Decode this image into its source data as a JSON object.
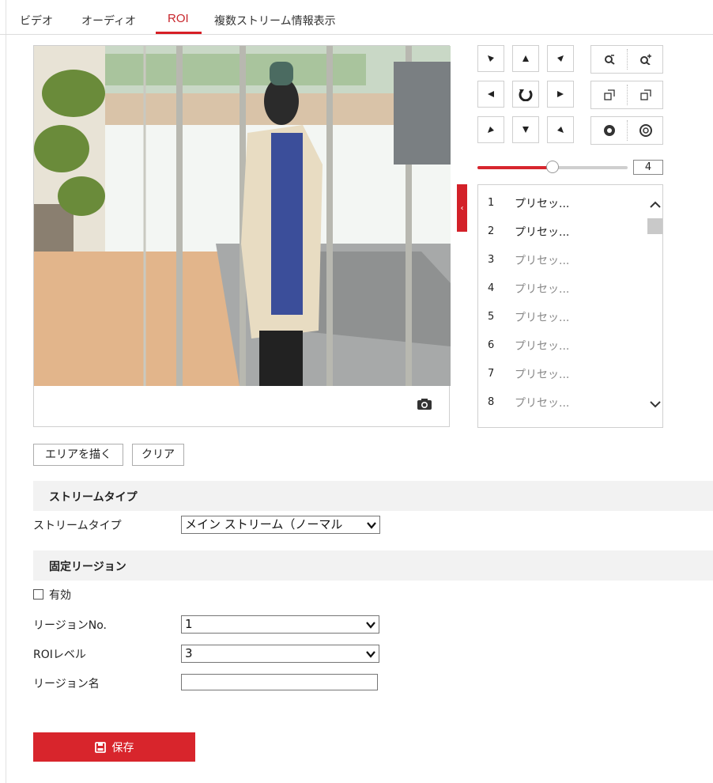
{
  "tabs": [
    {
      "label": "ビデオ"
    },
    {
      "label": "オーディオ"
    },
    {
      "label": "ROI",
      "active": true
    },
    {
      "label": "複数ストリーム情報表示"
    }
  ],
  "colors": {
    "accent": "#d8252c"
  },
  "ptz": {
    "direction_icons": [
      "arrow-up-left-icon",
      "arrow-up-icon",
      "arrow-up-right-icon",
      "arrow-left-icon",
      "auto-rotate-icon",
      "arrow-right-icon",
      "arrow-down-left-icon",
      "arrow-down-icon",
      "arrow-down-right-icon"
    ],
    "lens_icons": [
      "zoom-out-icon",
      "zoom-in-icon",
      "focus-near-icon",
      "focus-far-icon",
      "iris-close-icon",
      "iris-open-icon"
    ],
    "speed": {
      "value": "4",
      "level": 0.5
    }
  },
  "presets": [
    {
      "num": "1",
      "name": "プリセッ..."
    },
    {
      "num": "2",
      "name": "プリセッ..."
    },
    {
      "num": "3",
      "name": "プリセッ..."
    },
    {
      "num": "4",
      "name": "プリセッ..."
    },
    {
      "num": "5",
      "name": "プリセッ..."
    },
    {
      "num": "6",
      "name": "プリセッ..."
    },
    {
      "num": "7",
      "name": "プリセッ..."
    },
    {
      "num": "8",
      "name": "プリセッ..."
    }
  ],
  "buttons": {
    "draw_area": "エリアを描く",
    "clear": "クリア",
    "save": "保存"
  },
  "stream_section": {
    "title": "ストリームタイプ",
    "field_label": "ストリームタイプ",
    "value": "メイン ストリーム（ノーマル"
  },
  "fixed_region": {
    "title": "固定リージョン",
    "enable_label": "有効",
    "region_no_label": "リージョンNo.",
    "region_no_value": "1",
    "roi_level_label": "ROIレベル",
    "roi_level_value": "3",
    "region_name_label": "リージョン名",
    "region_name_value": ""
  }
}
